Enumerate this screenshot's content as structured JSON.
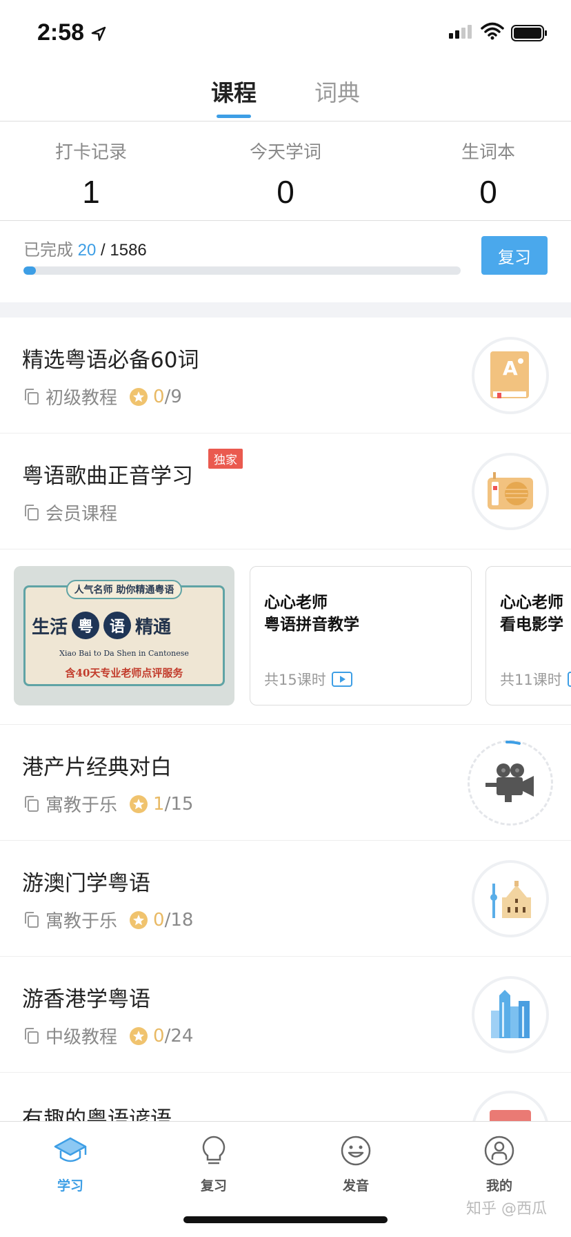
{
  "status_bar": {
    "time": "2:58"
  },
  "top_tabs": [
    {
      "label": "课程",
      "active": true
    },
    {
      "label": "词典",
      "active": false
    }
  ],
  "stats": [
    {
      "label": "打卡记录",
      "value": "1"
    },
    {
      "label": "今天学词",
      "value": "0"
    },
    {
      "label": "生词本",
      "value": "0"
    }
  ],
  "progress": {
    "prefix": "已完成",
    "done": "20",
    "sep": " / ",
    "total": "1586",
    "fraction": 0.0126,
    "button": "复习"
  },
  "courses": [
    {
      "title": "精选粤语必备60词",
      "category": "初级教程",
      "done": "0",
      "total": "/9",
      "thumb": "book-icon"
    },
    {
      "title": "粤语歌曲正音学习",
      "category": "会员课程",
      "badge": "独家",
      "thumb": "radio-icon"
    },
    {
      "title": "港产片经典对白",
      "category": "寓教于乐",
      "done": "1",
      "total": "/15",
      "thumb": "movie-camera-icon"
    },
    {
      "title": "游澳门学粤语",
      "category": "寓教于乐",
      "done": "0",
      "total": "/18",
      "thumb": "macau-ruins-icon"
    },
    {
      "title": "游香港学粤语",
      "category": "中级教程",
      "done": "0",
      "total": "/24",
      "thumb": "hong-kong-skyline-icon"
    },
    {
      "title": "有趣的粤语谚语",
      "thumb": "red-icon"
    }
  ],
  "promo": {
    "ribbon": "人气名师 助你精通粤语",
    "left": "生活",
    "c1": "粤",
    "c2": "语",
    "right": "精通",
    "english": "Xiao Bai to Da Shen in Cantonese",
    "service": "含40天专业老师点评服务"
  },
  "lessons": [
    {
      "title": "心心老师\n粤语拼音教学",
      "count": "共15课时"
    },
    {
      "title": "心心老师\n看电影学",
      "count": "共11课时"
    }
  ],
  "bottom_nav": [
    {
      "label": "学习",
      "icon": "graduation-cap-icon",
      "active": true
    },
    {
      "label": "复习",
      "icon": "lightbulb-icon",
      "active": false
    },
    {
      "label": "发音",
      "icon": "smiley-icon",
      "active": false
    },
    {
      "label": "我的",
      "icon": "user-icon",
      "active": false
    }
  ],
  "watermark": "知乎 @西瓜",
  "colors": {
    "accent": "#3d9ee5",
    "star": "#e8b964",
    "badge": "#ea5a4f"
  }
}
